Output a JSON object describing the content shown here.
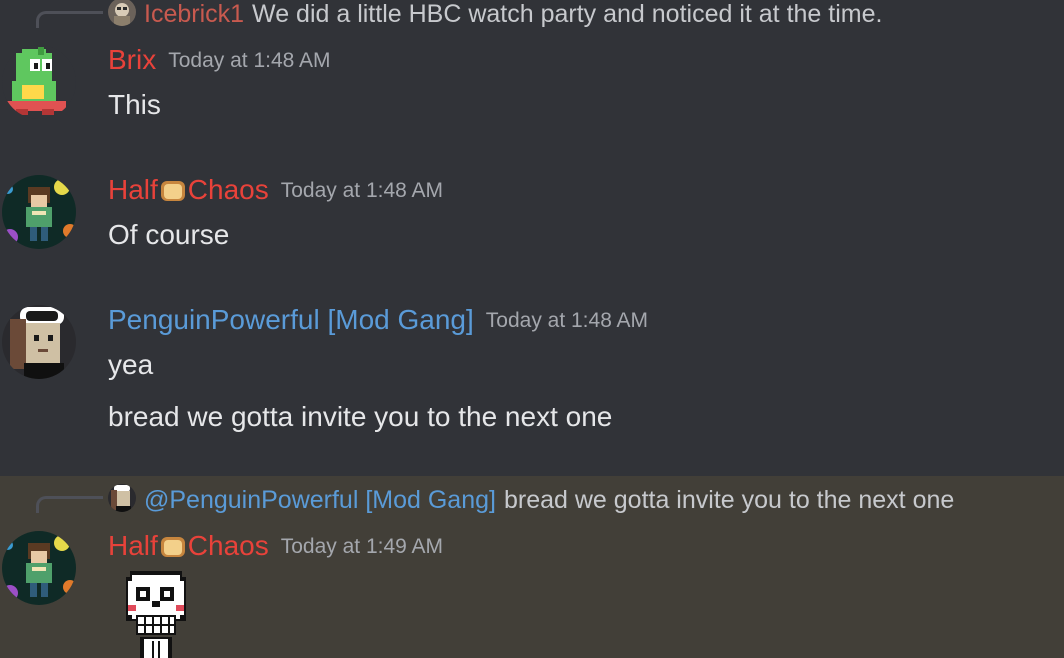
{
  "colors": {
    "background": "#313338",
    "highlight_background": "#423f38",
    "red_role": "#e8423a",
    "blue_role": "#5a9bd8",
    "timestamp": "#a4a7ad",
    "text": "#e6e7e9"
  },
  "top_reply": {
    "name": "Icebrick1",
    "text": "We did a little HBC watch party and noticed it at the time."
  },
  "messages": [
    {
      "author": "Brix",
      "timestamp": "Today at 1:48 AM",
      "lines": [
        "This"
      ]
    },
    {
      "author_pre": "Half",
      "author_emoji": "bread-emoji",
      "author_post": "Chaos",
      "timestamp": "Today at 1:48 AM",
      "lines": [
        "Of course"
      ]
    },
    {
      "author": "PenguinPowerful [Mod Gang]",
      "timestamp": "Today at 1:48 AM",
      "lines": [
        "yea",
        "bread we gotta invite you to the next one"
      ]
    },
    {
      "reply": {
        "mention": "@PenguinPowerful [Mod Gang]",
        "text": "bread we gotta invite you to the next one"
      },
      "author_pre": "Half",
      "author_emoji": "bread-emoji",
      "author_post": "Chaos",
      "timestamp": "Today at 1:49 AM",
      "attachment": "papyrus-skull-sticker"
    }
  ]
}
